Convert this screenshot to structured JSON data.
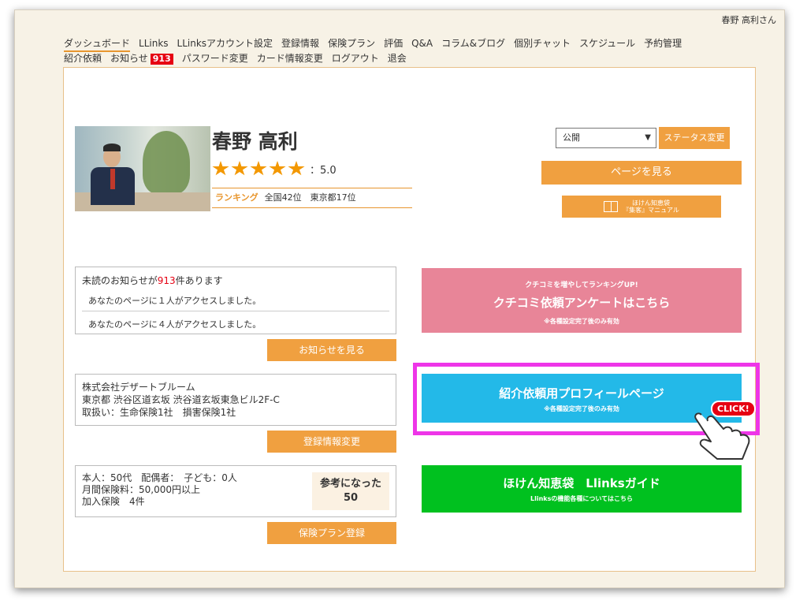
{
  "header": {
    "user_name": "春野 高利さん"
  },
  "nav": {
    "row1": [
      "ダッシュボード",
      "LLinks",
      "LLinksアカウント設定",
      "登録情報",
      "保険プラン",
      "評価",
      "Q&A",
      "コラム&ブログ",
      "個別チャット",
      "スケジュール",
      "予約管理"
    ],
    "row2_a": [
      "紹介依頼",
      "お知らせ"
    ],
    "notice_badge": "913",
    "row2_b": [
      "パスワード変更",
      "カード情報変更",
      "ログアウト",
      "退会"
    ]
  },
  "profile": {
    "name": "春野 高利",
    "rating": "：5.0",
    "stars": 5,
    "ranking_label": "ランキング",
    "ranking_value": "全国42位　東京都17位"
  },
  "status": {
    "selected": "公開",
    "change_button": "ステータス変更",
    "view_page_button": "ページを見る",
    "manual_line1": "ほけん知恵袋",
    "manual_line2": "『集客』マニュアル"
  },
  "notices": {
    "title_prefix": "未読のお知らせが",
    "count": "913",
    "title_suffix": "件あります",
    "items": [
      "あなたのページに１人がアクセスしました。",
      "あなたのページに４人がアクセスしました。"
    ],
    "button": "お知らせを見る"
  },
  "company": {
    "name": "株式会社デザートブルーム",
    "address": "東京都 渋谷区道玄坂 渋谷道玄坂東急ビル2F-C",
    "handling": "取扱い：生命保険1社　損害保険1社",
    "button": "登録情報変更"
  },
  "plan": {
    "line1": "本人：50代　配偶者：　子ども：0人",
    "line2": "月間保険料：50,000円以上",
    "line3": "加入保険　4件",
    "helpful_label": "参考になった",
    "helpful_count": "50",
    "button": "保険プラン登録"
  },
  "review_banner": {
    "small": "クチコミを増やしてランキングUP!",
    "large": "クチコミ依頼アンケートはこちら",
    "note": "※各種設定完了後のみ有効"
  },
  "referral_banner": {
    "large": "紹介依頼用プロフィールページ",
    "note": "※各種設定完了後のみ有効"
  },
  "guide_banner": {
    "large": "ほけん知恵袋　Llinksガイド",
    "note": "Llinksの機能各種についてはこちら"
  },
  "annotation": {
    "click_label": "CLICK!"
  },
  "colors": {
    "accent": "#f0a040",
    "review": "#e88598",
    "referral": "#23b9e8",
    "guide": "#00c11f",
    "highlight": "#ee35e8"
  }
}
